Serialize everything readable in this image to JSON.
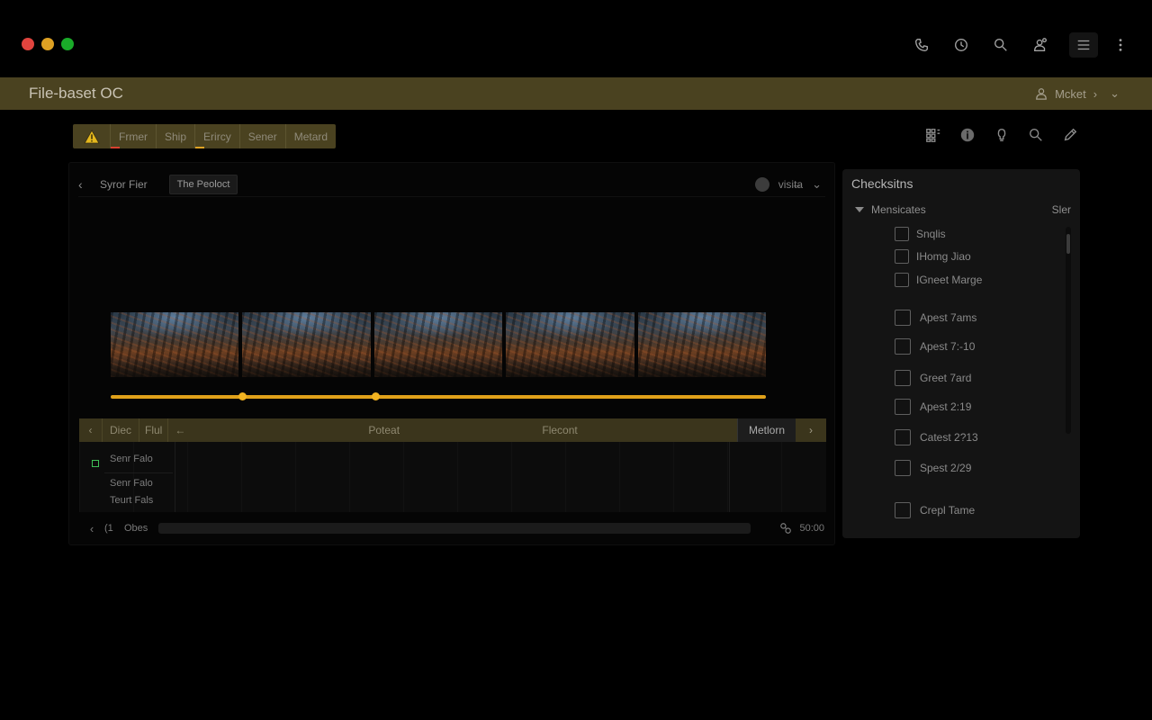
{
  "window": {
    "controls": [
      "close",
      "minimize",
      "maximize"
    ],
    "top_icons": [
      "phone-icon",
      "clock-icon",
      "search-icon",
      "user-settings-icon",
      "menu-icon",
      "more-vertical-icon"
    ]
  },
  "titlebar": {
    "title": "File-baset OC",
    "user": "Mcket"
  },
  "toolbar": {
    "items": [
      "Frmer",
      "Ship",
      "Erircy",
      "Sener",
      "Metard"
    ]
  },
  "right_tools": [
    "grid-icon",
    "info-icon",
    "bulb-icon",
    "search-icon",
    "pencil-icon"
  ],
  "panel": {
    "crumb": "Syror Fier",
    "chip": "The Peoloct",
    "view_label": "visit̶a"
  },
  "tracks": {
    "head": {
      "col1": "Diec",
      "col2": "Flul",
      "col3": "Poteat",
      "col4": "Flecont",
      "medium": "Metlorn"
    },
    "rows": [
      "Senr Falo",
      "Senr Falo",
      "Teurt Fals"
    ]
  },
  "footer": {
    "play": "(1",
    "label": "Obes",
    "time": "50:00"
  },
  "side": {
    "title": "Checksitns",
    "group": "Mensicates",
    "filter": "Sler",
    "items": [
      "Snqlis",
      "IHomg Jiao",
      "IGneet Marge",
      "Apest 7ams",
      "Apest 7:-10",
      "Greet 7ard",
      "Apest 2:19",
      "Catest 2?13",
      "Spest 2/29",
      "Crepl Tame"
    ]
  },
  "colors": {
    "accent_bar": "#4a4220",
    "timeline": "#e0a11a"
  }
}
